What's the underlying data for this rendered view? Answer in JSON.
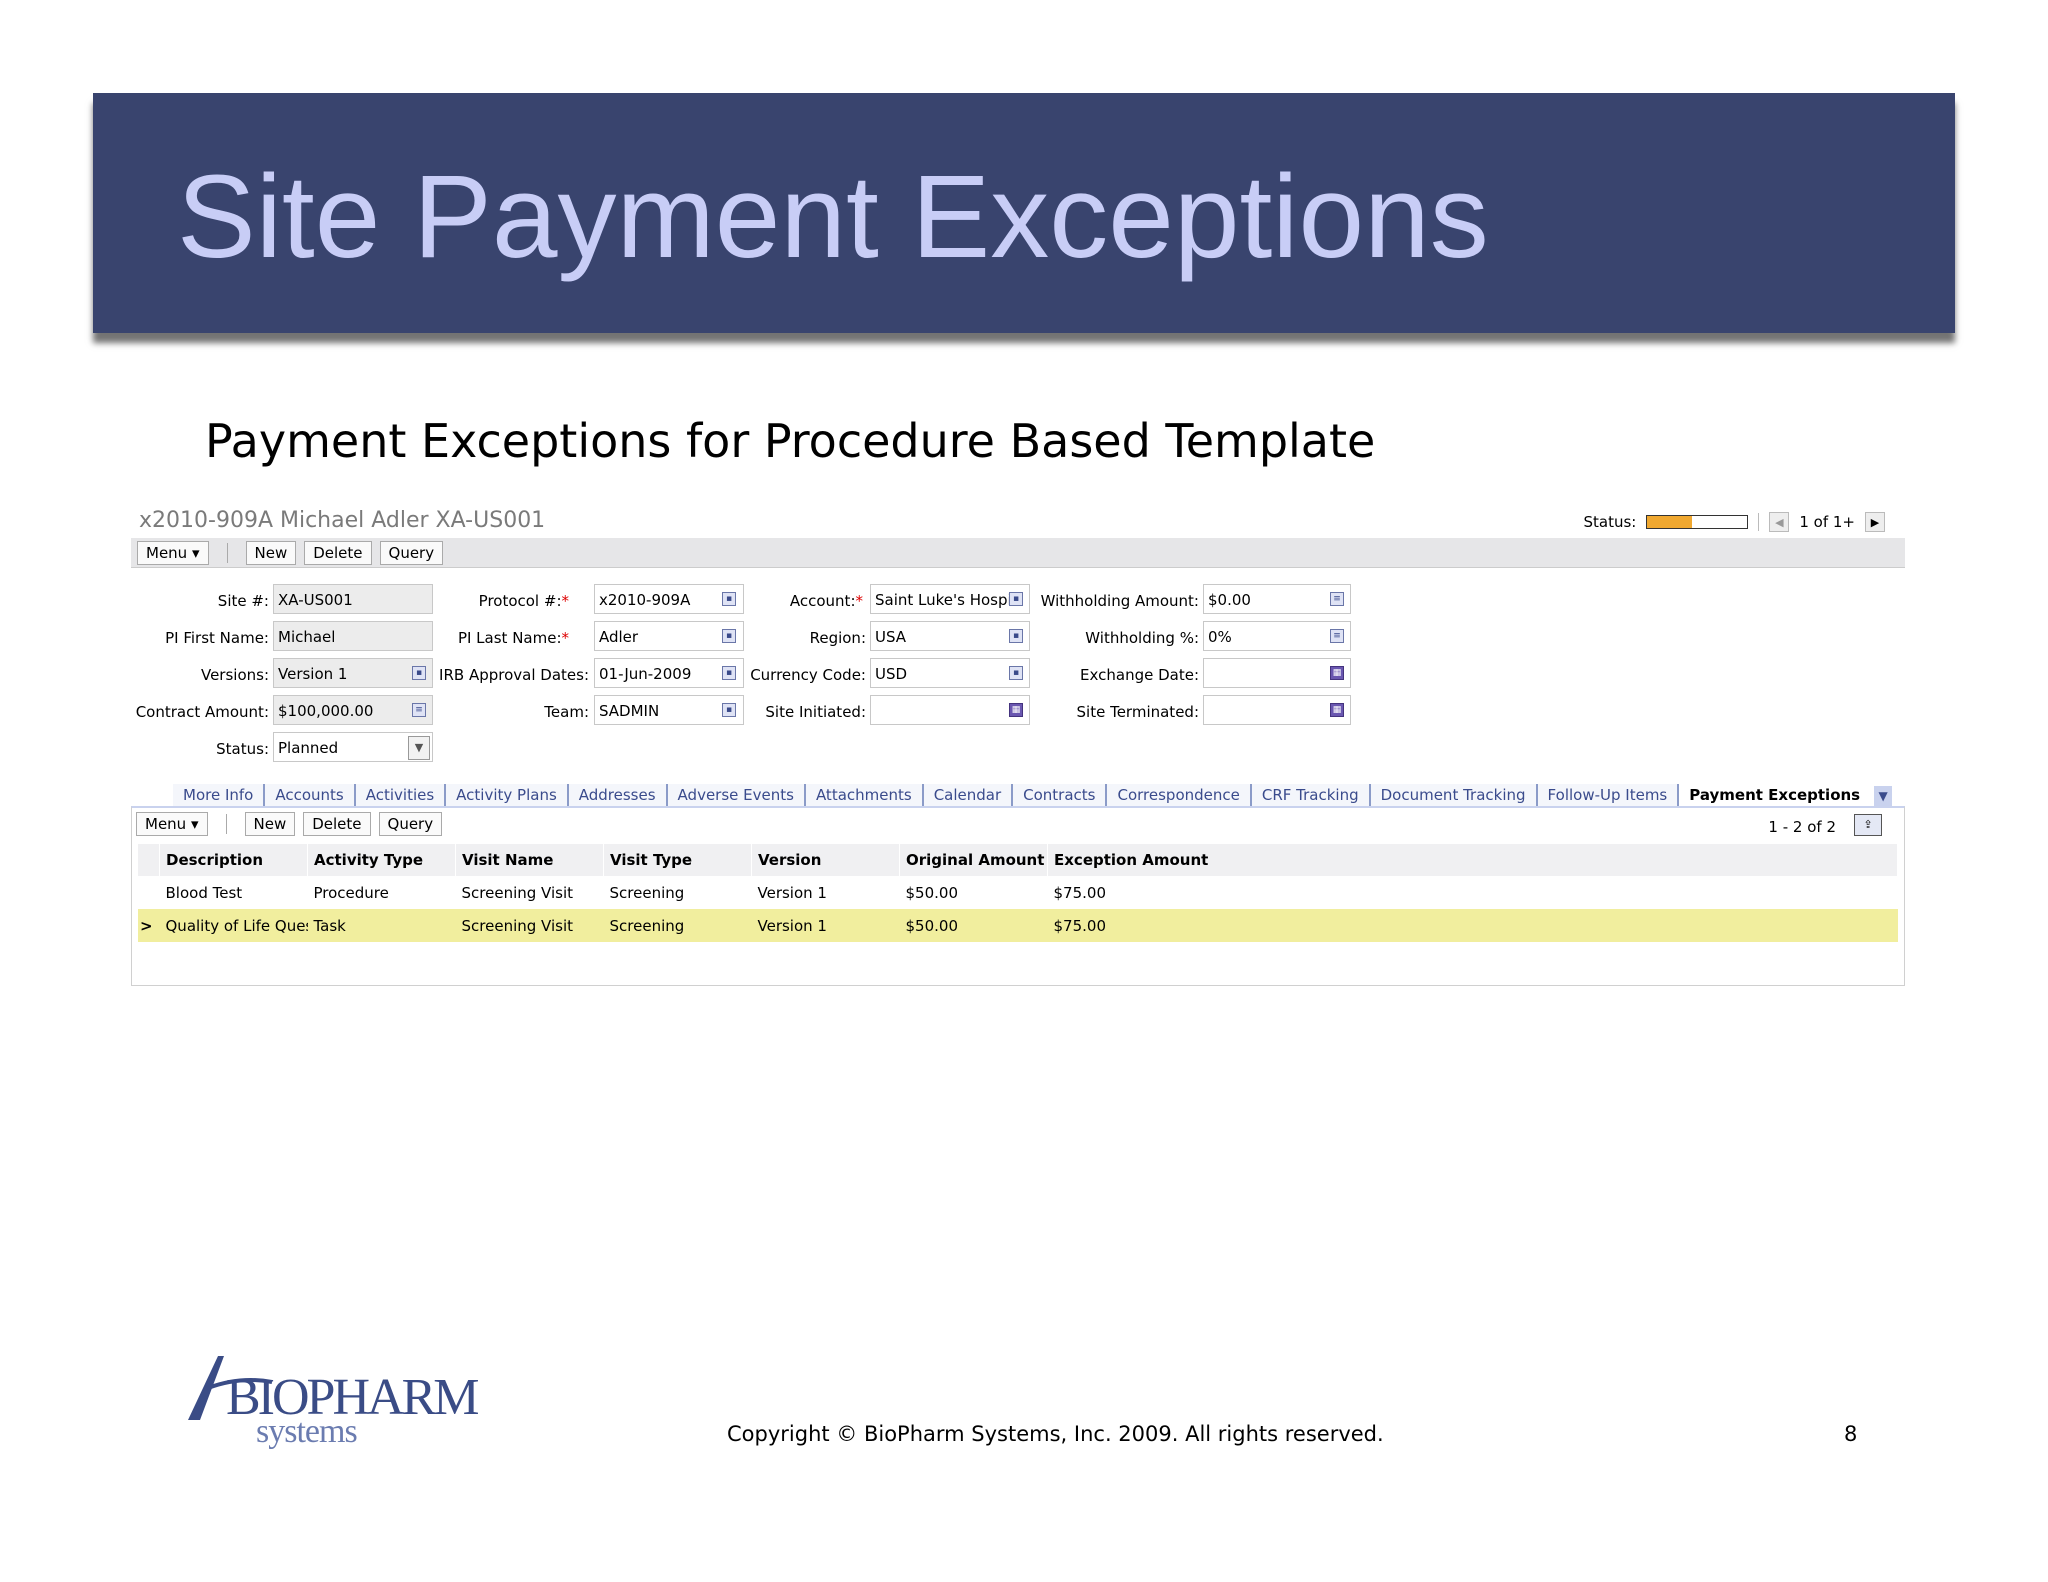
{
  "slide": {
    "title": "Site Payment Exceptions",
    "subtitle": "Payment Exceptions for Procedure Based Template",
    "copyright": "Copyright © BioPharm Systems, Inc.  2009.  All rights reserved.",
    "page_number": "8",
    "logo": {
      "name": "BioPharm Systems",
      "text_main": "BIOPHARM",
      "text_sub": "systems"
    }
  },
  "record": {
    "title": "x2010-909A Michael Adler XA-US001",
    "status_label": "Status:",
    "status_fill_fraction": 0.45,
    "status_color": "#f0a830",
    "pager": "1 of 1+"
  },
  "toolbar": {
    "menu": "Menu",
    "new": "New",
    "delete": "Delete",
    "query": "Query"
  },
  "form": {
    "col1": [
      {
        "label": "Site #:",
        "value": "XA-US001"
      },
      {
        "label": "PI First Name:",
        "value": "Michael"
      },
      {
        "label": "Versions:",
        "value": "Version 1"
      },
      {
        "label": "Contract Amount:",
        "value": "$100,000.00"
      },
      {
        "label": "Status:",
        "value": "Planned"
      }
    ],
    "col2": [
      {
        "label": "Protocol #:",
        "value": "x2010-909A"
      },
      {
        "label": "PI Last Name:",
        "value": "Adler"
      },
      {
        "label": "IRB Approval Dates:",
        "value": "01-Jun-2009"
      },
      {
        "label": "Team:",
        "value": "SADMIN"
      }
    ],
    "col3": [
      {
        "label": "Account:",
        "value": "Saint Luke's Hospit."
      },
      {
        "label": "Region:",
        "value": "USA"
      },
      {
        "label": "Currency Code:",
        "value": "USD"
      },
      {
        "label": "Site Initiated:",
        "value": ""
      }
    ],
    "col4": [
      {
        "label": "Withholding Amount:",
        "value": "$0.00"
      },
      {
        "label": "Withholding %:",
        "value": "0%"
      },
      {
        "label": "Exchange Date:",
        "value": ""
      },
      {
        "label": "Site Terminated:",
        "value": ""
      }
    ],
    "required_mark": "*"
  },
  "tabs": [
    "More Info",
    "Accounts",
    "Activities",
    "Activity Plans",
    "Addresses",
    "Adverse Events",
    "Attachments",
    "Calendar",
    "Contracts",
    "Correspondence",
    "CRF Tracking",
    "Document Tracking",
    "Follow-Up Items",
    "Payment Exceptions"
  ],
  "list": {
    "count": "1 - 2 of 2",
    "selected_marker": ">",
    "columns": [
      "Description",
      "Activity Type",
      "Visit Name",
      "Visit Type",
      "Version",
      "Original Amount",
      "Exception Amount"
    ],
    "rows": [
      [
        "Blood Test",
        "Procedure",
        "Screening Visit",
        "Screening",
        "Version 1",
        "$50.00",
        "$75.00"
      ],
      [
        "Quality of Life Quest",
        "Task",
        "Screening Visit",
        "Screening",
        "Version 1",
        "$50.00",
        "$75.00"
      ]
    ],
    "selected_color": "#f1ee9e"
  }
}
